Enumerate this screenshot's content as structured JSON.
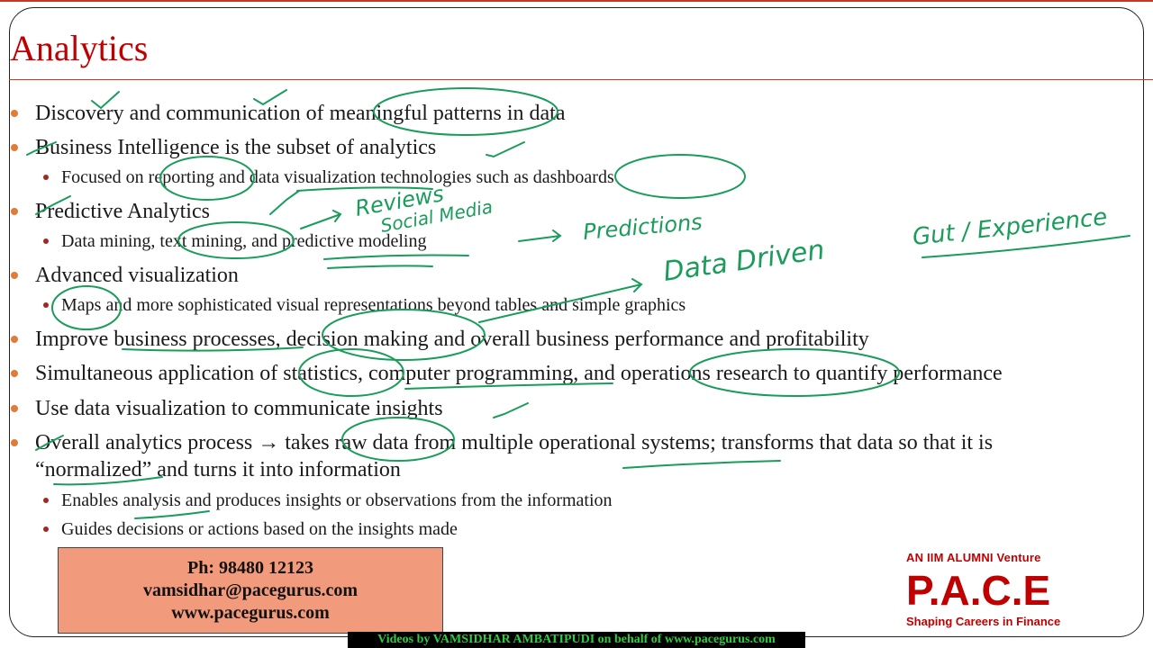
{
  "slide": {
    "title": "Analytics",
    "bullets": [
      {
        "level": 1,
        "text": "Discovery and communication of meaningful patterns in data"
      },
      {
        "level": 1,
        "text": "Business Intelligence is the subset of analytics"
      },
      {
        "level": 2,
        "text": "Focused on reporting and data visualization technologies such as dashboards"
      },
      {
        "level": 1,
        "text": "Predictive Analytics"
      },
      {
        "level": 2,
        "text": "Data mining, text mining, and predictive modeling"
      },
      {
        "level": 1,
        "text": "Advanced visualization"
      },
      {
        "level": 2,
        "text": "Maps and more sophisticated visual representations beyond tables and simple graphics"
      },
      {
        "level": 1,
        "text": "Improve business processes, decision making and overall business performance and profitability"
      },
      {
        "level": 1,
        "text": "Simultaneous application of statistics, computer programming, and operations research to quantify performance"
      },
      {
        "level": 1,
        "text": "Use data visualization to communicate insights"
      },
      {
        "level": 1,
        "text": "Overall analytics process → takes raw data from multiple operational systems; transforms that data so that it is"
      },
      {
        "level": 1,
        "text": "“normalized” and turns it into information"
      },
      {
        "level": 2,
        "text": "Enables analysis and produces insights or observations from the information"
      },
      {
        "level": 2,
        "text": "Guides decisions or actions based on the insights made"
      }
    ]
  },
  "annotations": {
    "reviews": "Reviews",
    "social_media": "Social Media",
    "predictions": "Predictions",
    "data_driven": "Data Driven",
    "gut_experience": "Gut / Experience",
    "ink_color": "#1a9c5a"
  },
  "contact": {
    "phone": "Ph: 98480 12123",
    "email": "vamsidhar@pacegurus.com",
    "website": "www.pacegurus.com"
  },
  "brand": {
    "tagline": "AN IIM ALUMNI Venture",
    "name": "P.A.C.E",
    "subtitle": "Shaping Careers in Finance",
    "color": "#c00000"
  },
  "footer": {
    "text": "Videos by VAMSIDHAR AMBATIPUDI on behalf of www.pacegurus.com"
  },
  "colors": {
    "title": "#c00000",
    "contact_box": "#f29a7c",
    "footer_text": "#2ecc40"
  }
}
